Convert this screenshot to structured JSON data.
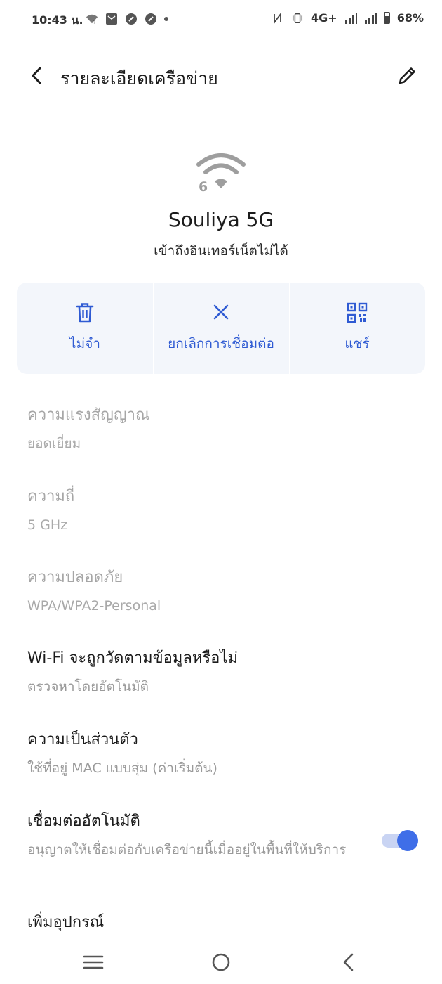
{
  "status_bar": {
    "time": "10:43 น.",
    "network_label": "4G+",
    "battery": "68%",
    "icons": [
      "wifi-question-icon",
      "mail-icon",
      "app-icon",
      "app-icon",
      "notification-dot-icon",
      "nfc-icon",
      "vibrate-icon",
      "signal-icon",
      "signal-icon",
      "battery-icon"
    ]
  },
  "header": {
    "title": "รายละเอียดเครือข่าย",
    "back_icon": "back-arrow-icon",
    "edit_icon": "pencil-icon"
  },
  "network": {
    "icon": "wifi-6-icon",
    "badge": "6",
    "name": "Souliya 5G",
    "status": "เข้าถึงอินเทอร์เน็ตไม่ได้"
  },
  "actions": [
    {
      "label": "ไม่จำ",
      "icon": "trash-icon"
    },
    {
      "label": "ยกเลิกการเชื่อมต่อ",
      "icon": "close-icon"
    },
    {
      "label": "แชร์",
      "icon": "qr-code-icon"
    }
  ],
  "details": {
    "signal": {
      "title": "ความแรงสัญญาณ",
      "value": "ยอดเยี่ยม"
    },
    "frequency": {
      "title": "ความถี่",
      "value": "5 GHz"
    },
    "security": {
      "title": "ความปลอดภัย",
      "value": "WPA/WPA2-Personal"
    },
    "metered": {
      "title": "Wi-Fi จะถูกวัดตามข้อมูลหรือไม่",
      "value": "ตรวจหาโดยอัตโนมัติ"
    },
    "privacy": {
      "title": "ความเป็นส่วนตัว",
      "value": "ใช้ที่อยู่ MAC แบบสุ่ม (ค่าเริ่มต้น)"
    },
    "auto_connect": {
      "title": "เชื่อมต่ออัตโนมัติ",
      "value": "อนุญาตให้เชื่อมต่อกับเครือข่ายนี้เมื่ออยู่ในพื้นที่ให้บริการ",
      "enabled": true
    },
    "add_device": {
      "title": "เพิ่มอุปกรณ์"
    }
  },
  "colors": {
    "accent": "#3f6ee8",
    "action_bg": "#f3f6fb",
    "action_text": "#2f5bd3",
    "dim_text": "#a6a6a6"
  },
  "nav": [
    "menu-icon",
    "home-icon",
    "back-icon"
  ]
}
